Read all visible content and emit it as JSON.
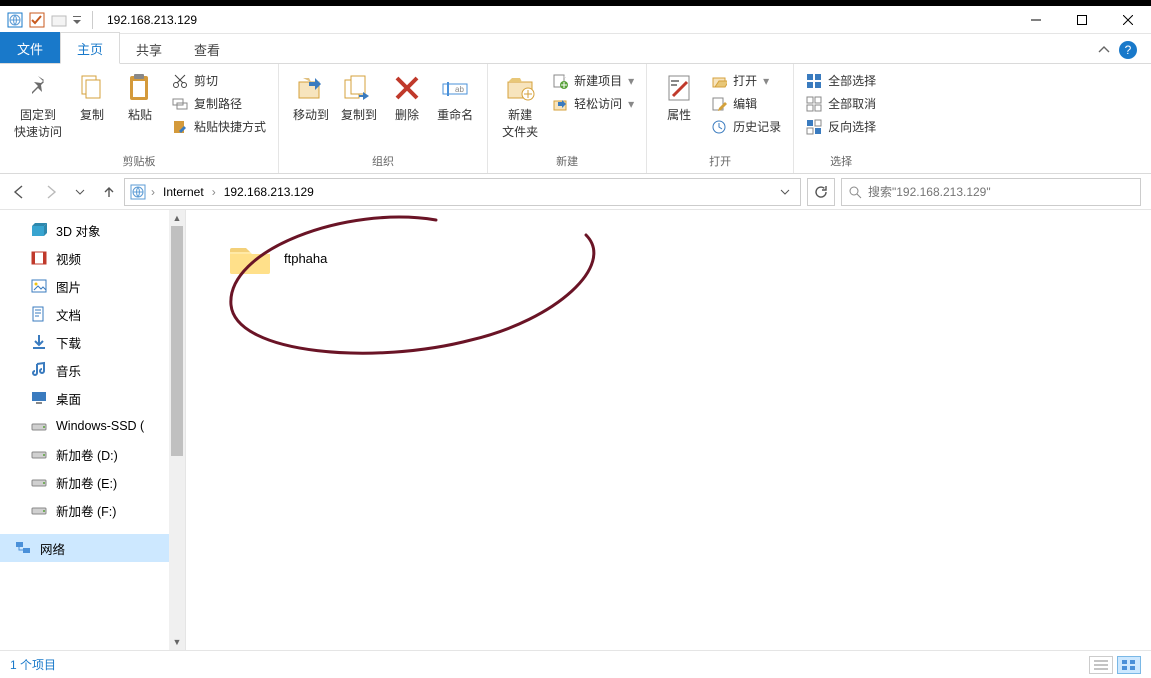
{
  "window_title": "192.168.213.129",
  "tabs": {
    "file": "文件",
    "main": "主页",
    "share": "共享",
    "view": "查看"
  },
  "ribbon": {
    "pin": "固定到\n快速访问",
    "copy": "复制",
    "paste": "粘贴",
    "cut": "剪切",
    "copy_path": "复制路径",
    "paste_shortcut": "粘贴快捷方式",
    "group_clip": "剪贴板",
    "moveto": "移动到",
    "copyto": "复制到",
    "delete": "删除",
    "rename": "重命名",
    "group_org": "组织",
    "newfolder": "新建\n文件夹",
    "newitem": "新建项目",
    "easyaccess": "轻松访问",
    "group_new": "新建",
    "properties": "属性",
    "open": "打开",
    "edit": "编辑",
    "history": "历史记录",
    "group_open": "打开",
    "selectall": "全部选择",
    "selectnone": "全部取消",
    "invert": "反向选择",
    "group_select": "选择"
  },
  "breadcrumb": {
    "root": "Internet",
    "leaf": "192.168.213.129"
  },
  "search_placeholder": "搜索\"192.168.213.129\"",
  "sidebar": [
    {
      "label": "3D 对象",
      "icon": "3d"
    },
    {
      "label": "视频",
      "icon": "video"
    },
    {
      "label": "图片",
      "icon": "pic"
    },
    {
      "label": "文档",
      "icon": "doc"
    },
    {
      "label": "下载",
      "icon": "dl"
    },
    {
      "label": "音乐",
      "icon": "music"
    },
    {
      "label": "桌面",
      "icon": "desk"
    },
    {
      "label": "Windows-SSD (",
      "icon": "drive"
    },
    {
      "label": "新加卷 (D:)",
      "icon": "drive"
    },
    {
      "label": "新加卷 (E:)",
      "icon": "drive"
    },
    {
      "label": "新加卷 (F:)",
      "icon": "drive"
    }
  ],
  "sidebar_selected": "网络",
  "folder_name": "ftphaha",
  "status_text": "1 个项目"
}
